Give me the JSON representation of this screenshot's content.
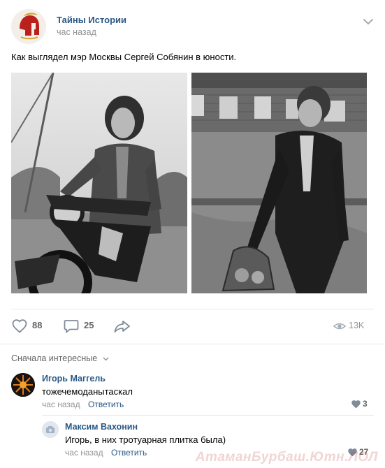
{
  "post": {
    "author": "Тайны Истории",
    "time": "час назад",
    "text": "Как выглядел мэр Москвы Сергей Собянин в юности."
  },
  "actions": {
    "likes": "88",
    "comments": "25",
    "views": "13K"
  },
  "comments_section": {
    "sort_label": "Сначала интересные"
  },
  "comments": [
    {
      "author": "Игорь Маггель",
      "text": "тожечемоданытаскал",
      "time": "час назад",
      "reply_label": "Ответить",
      "likes": "3"
    },
    {
      "author": "Максим Вахонин",
      "text": "Игорь, в них тротуарная плитка была)",
      "time": "час назад",
      "reply_label": "Ответить",
      "likes": "27"
    }
  ],
  "watermark": "АтаманБурбаш.Ютн.ЛОЛ",
  "colors": {
    "link": "#2a5885",
    "muted": "#939393",
    "icon": "#818c99",
    "divider": "#e7e8ec"
  },
  "icons": [
    "chevron-down-icon",
    "heart-icon",
    "comment-icon",
    "share-icon",
    "eye-icon",
    "reply-heart-icon"
  ]
}
